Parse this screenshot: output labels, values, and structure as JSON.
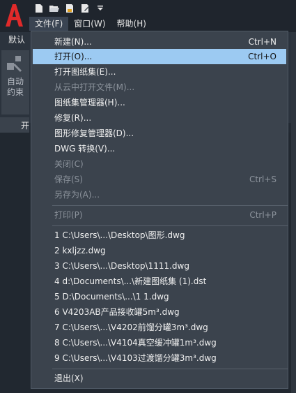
{
  "menubar": {
    "items": [
      "文件(F)",
      "窗口(W)",
      "帮助(H)"
    ]
  },
  "ribbon": {
    "tab_label": "默认",
    "panel_label": "自动约束",
    "doc_tab_label": "开"
  },
  "menu": {
    "items": [
      {
        "label": "新建(N)...",
        "shortcut": "Ctrl+N"
      },
      {
        "label": "打开(O)...",
        "shortcut": "Ctrl+O"
      },
      {
        "label": "打开图纸集(E)...",
        "shortcut": ""
      },
      {
        "label": "从云中打开文件(M)...",
        "shortcut": ""
      },
      {
        "label": "图纸集管理器(H)...",
        "shortcut": ""
      },
      {
        "label": "修复(R)...",
        "shortcut": ""
      },
      {
        "label": "图形修复管理器(D)...",
        "shortcut": ""
      },
      {
        "label": "DWG 转换(V)...",
        "shortcut": ""
      },
      {
        "label": "关闭(C)",
        "shortcut": ""
      },
      {
        "label": "保存(S)",
        "shortcut": "Ctrl+S"
      },
      {
        "label": "另存为(A)...",
        "shortcut": ""
      },
      {
        "label": "打印(P)",
        "shortcut": "Ctrl+P"
      },
      {
        "label": "1 C:\\Users\\...\\Desktop\\图形.dwg",
        "shortcut": ""
      },
      {
        "label": "2 kxljzz.dwg",
        "shortcut": ""
      },
      {
        "label": "3 C:\\Users\\...\\Desktop\\1111.dwg",
        "shortcut": ""
      },
      {
        "label": "4 d:\\Documents\\...\\新建图纸集 (1).dst",
        "shortcut": ""
      },
      {
        "label": "5 D:\\Documents\\...\\1 1.dwg",
        "shortcut": ""
      },
      {
        "label": "6 V4203AB产品接收罐5m³.dwg",
        "shortcut": ""
      },
      {
        "label": "7 C:\\Users\\...\\V4202前馏分罐3m³.dwg",
        "shortcut": ""
      },
      {
        "label": "8 C:\\Users\\...\\V4104真空缓冲罐1m³.dwg",
        "shortcut": ""
      },
      {
        "label": "9 C:\\Users\\...\\V4103过渡馏分罐3m³.dwg",
        "shortcut": ""
      },
      {
        "label": "退出(X)",
        "shortcut": ""
      }
    ]
  }
}
